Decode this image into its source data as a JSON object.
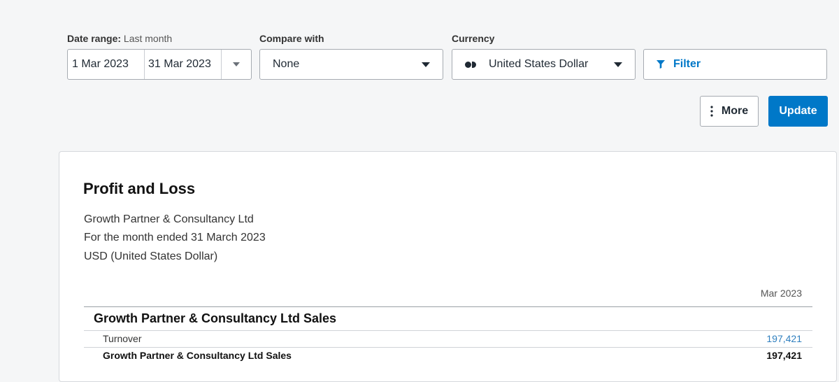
{
  "toolbar": {
    "date_range": {
      "label": "Date range:",
      "preset": "Last month",
      "start": "1 Mar 2023",
      "end": "31 Mar 2023"
    },
    "compare": {
      "label": "Compare with",
      "value": "None"
    },
    "currency": {
      "label": "Currency",
      "value": "United States Dollar"
    },
    "filter_label": "Filter",
    "more_label": "More",
    "update_label": "Update"
  },
  "report": {
    "title": "Profit and Loss",
    "org": "Growth Partner & Consultancy Ltd",
    "period": "For the month ended 31 March 2023",
    "currency": "USD (United States Dollar)",
    "column_header": "Mar 2023",
    "section": {
      "title": "Growth Partner & Consultancy Ltd Sales",
      "rows": [
        {
          "label": "Turnover",
          "value": "197,421"
        }
      ],
      "total": {
        "label": "Growth Partner & Consultancy Ltd Sales",
        "value": "197,421"
      }
    }
  },
  "colors": {
    "accent": "#0078c8",
    "link": "#2f7fbf",
    "background": "#f5f6f7"
  },
  "icons": [
    "chevron-down-icon",
    "filter-icon",
    "kebab-icon",
    "currency-icon"
  ]
}
